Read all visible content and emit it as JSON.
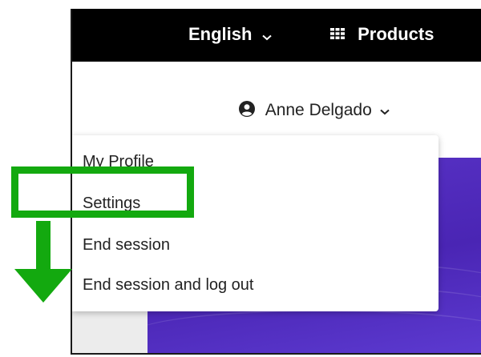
{
  "header": {
    "language_label": "English",
    "products_label": "Products"
  },
  "user_menu": {
    "user_name": "Anne Delgado",
    "items": [
      {
        "label": "My Profile"
      },
      {
        "label": "Settings"
      },
      {
        "label": "End session"
      },
      {
        "label": "End session and log out"
      }
    ],
    "highlighted_item": "Settings"
  },
  "icons": {
    "language_chevron": "chevron-down-icon",
    "products": "grid-icon",
    "user": "user-circle-icon",
    "user_chevron": "chevron-down-icon",
    "annotation_arrow": "arrow-down-icon"
  },
  "colors": {
    "topbar": "#000000",
    "annotation_green": "#13a90f",
    "panel_purple": "#4a25b4"
  }
}
